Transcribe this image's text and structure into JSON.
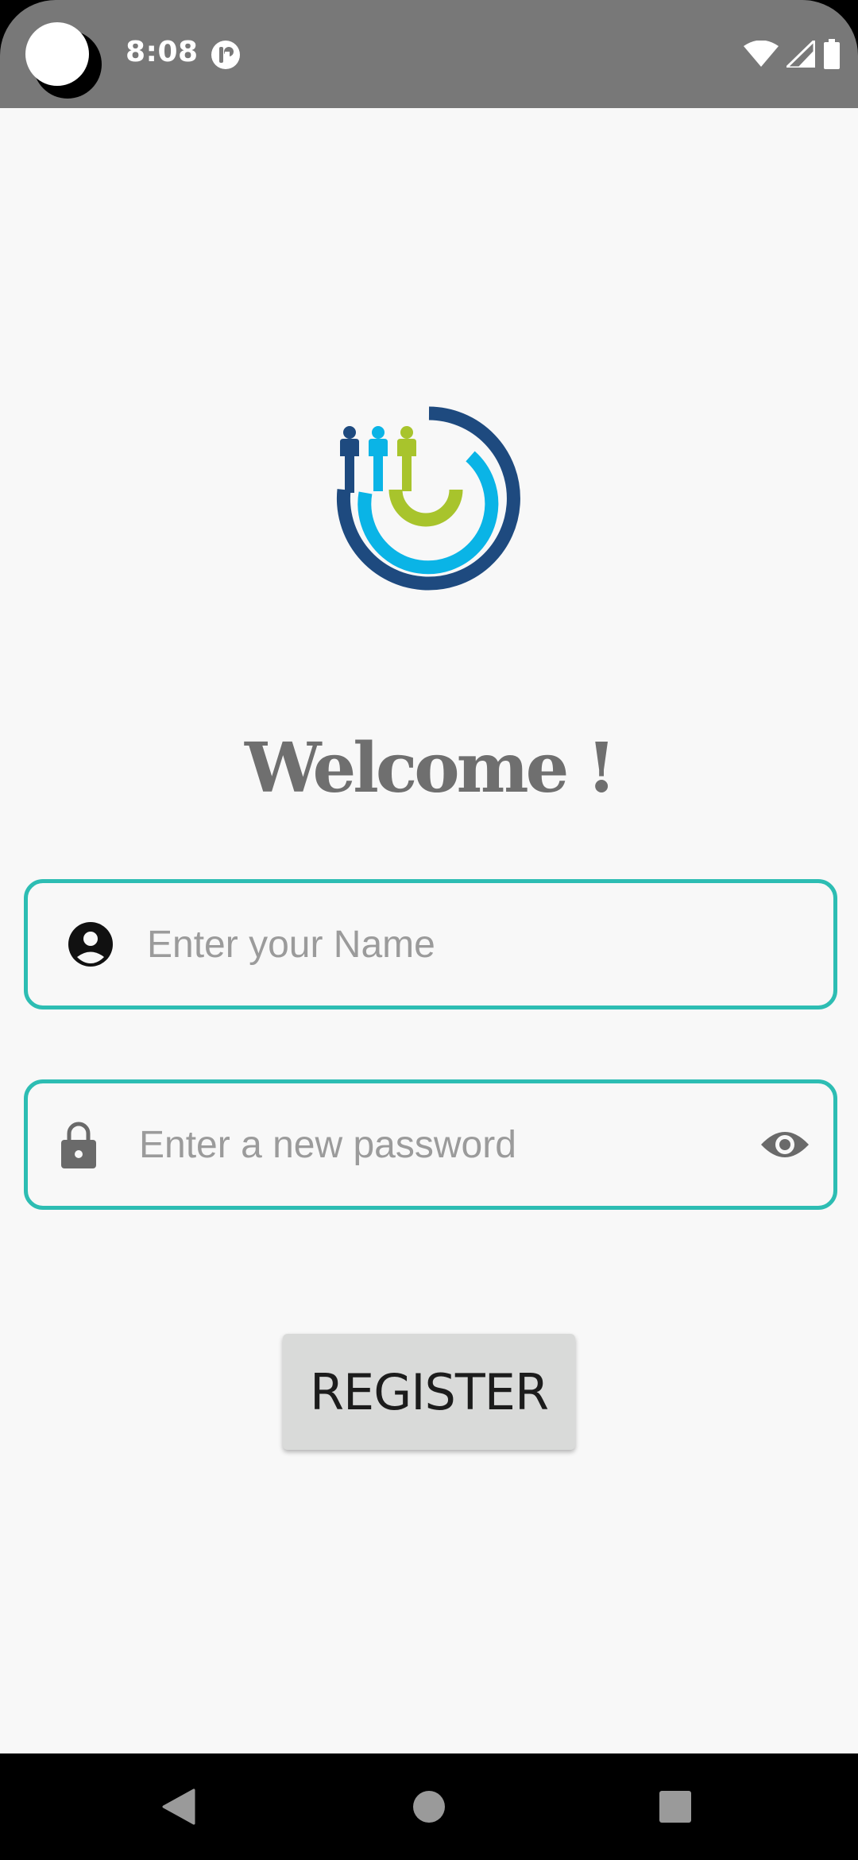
{
  "status_bar": {
    "time": "8:08",
    "app_icon": "notification-app-icon",
    "icons": [
      "wifi-icon",
      "cellular-signal-icon",
      "battery-icon"
    ]
  },
  "logo": {
    "icon": "people-arc-logo-icon",
    "colors": {
      "navy": "#1e4a7f",
      "cyan": "#0ab4e6",
      "lime": "#a8c42c"
    }
  },
  "welcome": {
    "title": "Welcome !"
  },
  "form": {
    "name_field": {
      "placeholder": "Enter your Name",
      "value": "",
      "icon": "account-circle-icon"
    },
    "password_field": {
      "placeholder": "Enter a new password",
      "value": "",
      "icon": "lock-icon",
      "toggle_icon": "eye-visibility-icon"
    },
    "border_color": "#2dbdb3"
  },
  "register_button": {
    "label": "REGISTER"
  },
  "nav_bar": {
    "buttons": [
      "back-icon",
      "home-icon",
      "recents-icon"
    ]
  }
}
